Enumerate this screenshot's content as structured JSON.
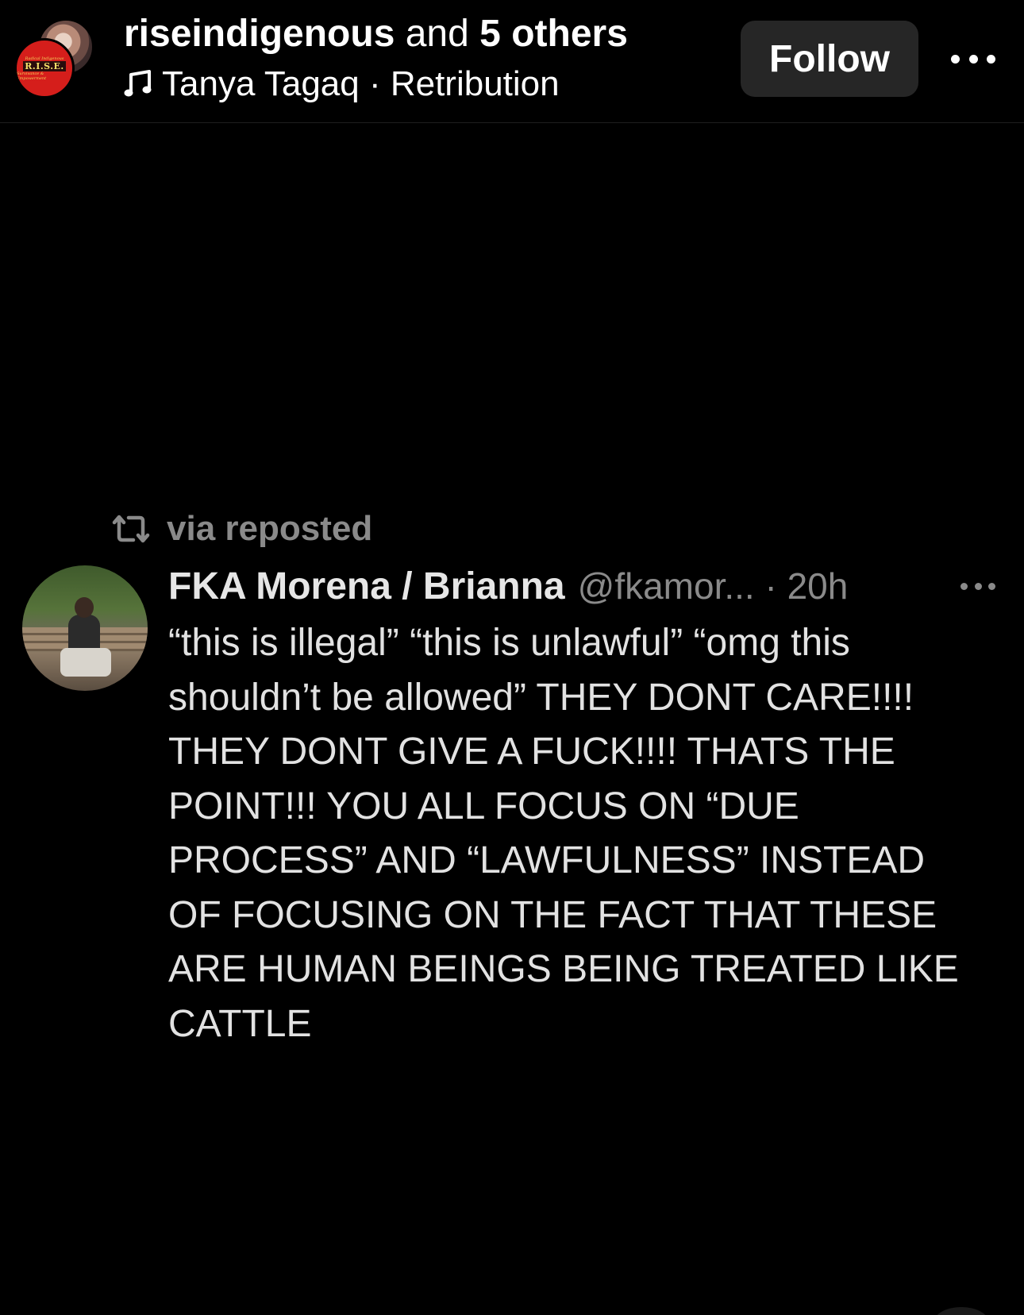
{
  "header": {
    "primary_user": "riseindigenous",
    "and_text": " and ",
    "others_text": "5 others",
    "music_artist_track": "Tanya Tagaq · Retribution",
    "follow_label": "Follow",
    "avatar_logo_text": "R.I.S.E.",
    "avatar_logo_small_top": "Radical Indigenous",
    "avatar_logo_small_bottom": "Survivance & Empowerment"
  },
  "tweet": {
    "repost_label": "via reposted",
    "display_name": "FKA Morena / Brianna",
    "handle_time": "@fkamor... · 20h",
    "body": "“this is illegal” “this is unlawful” “omg this\nshouldn’t be allowed” THEY DONT CARE!!!!\nTHEY DONT GIVE A FUCK!!!! THATS THE\nPOINT!!! YOU ALL FOCUS ON “DUE\nPROCESS” AND “LAWFULNESS” INSTEAD\nOF FOCUSING ON THE FACT THAT THESE\nARE HUMAN BEINGS BEING TREATED LIKE\nCATTLE"
  },
  "icons": {
    "music": "music-note-icon",
    "more": "more-horizontal-icon",
    "repost": "repost-icon"
  },
  "colors": {
    "background": "#000000",
    "follow_button_bg": "#262626",
    "muted_text": "#8a8a8a",
    "primary_text": "#ffffff",
    "logo_red": "#d51e1b"
  }
}
